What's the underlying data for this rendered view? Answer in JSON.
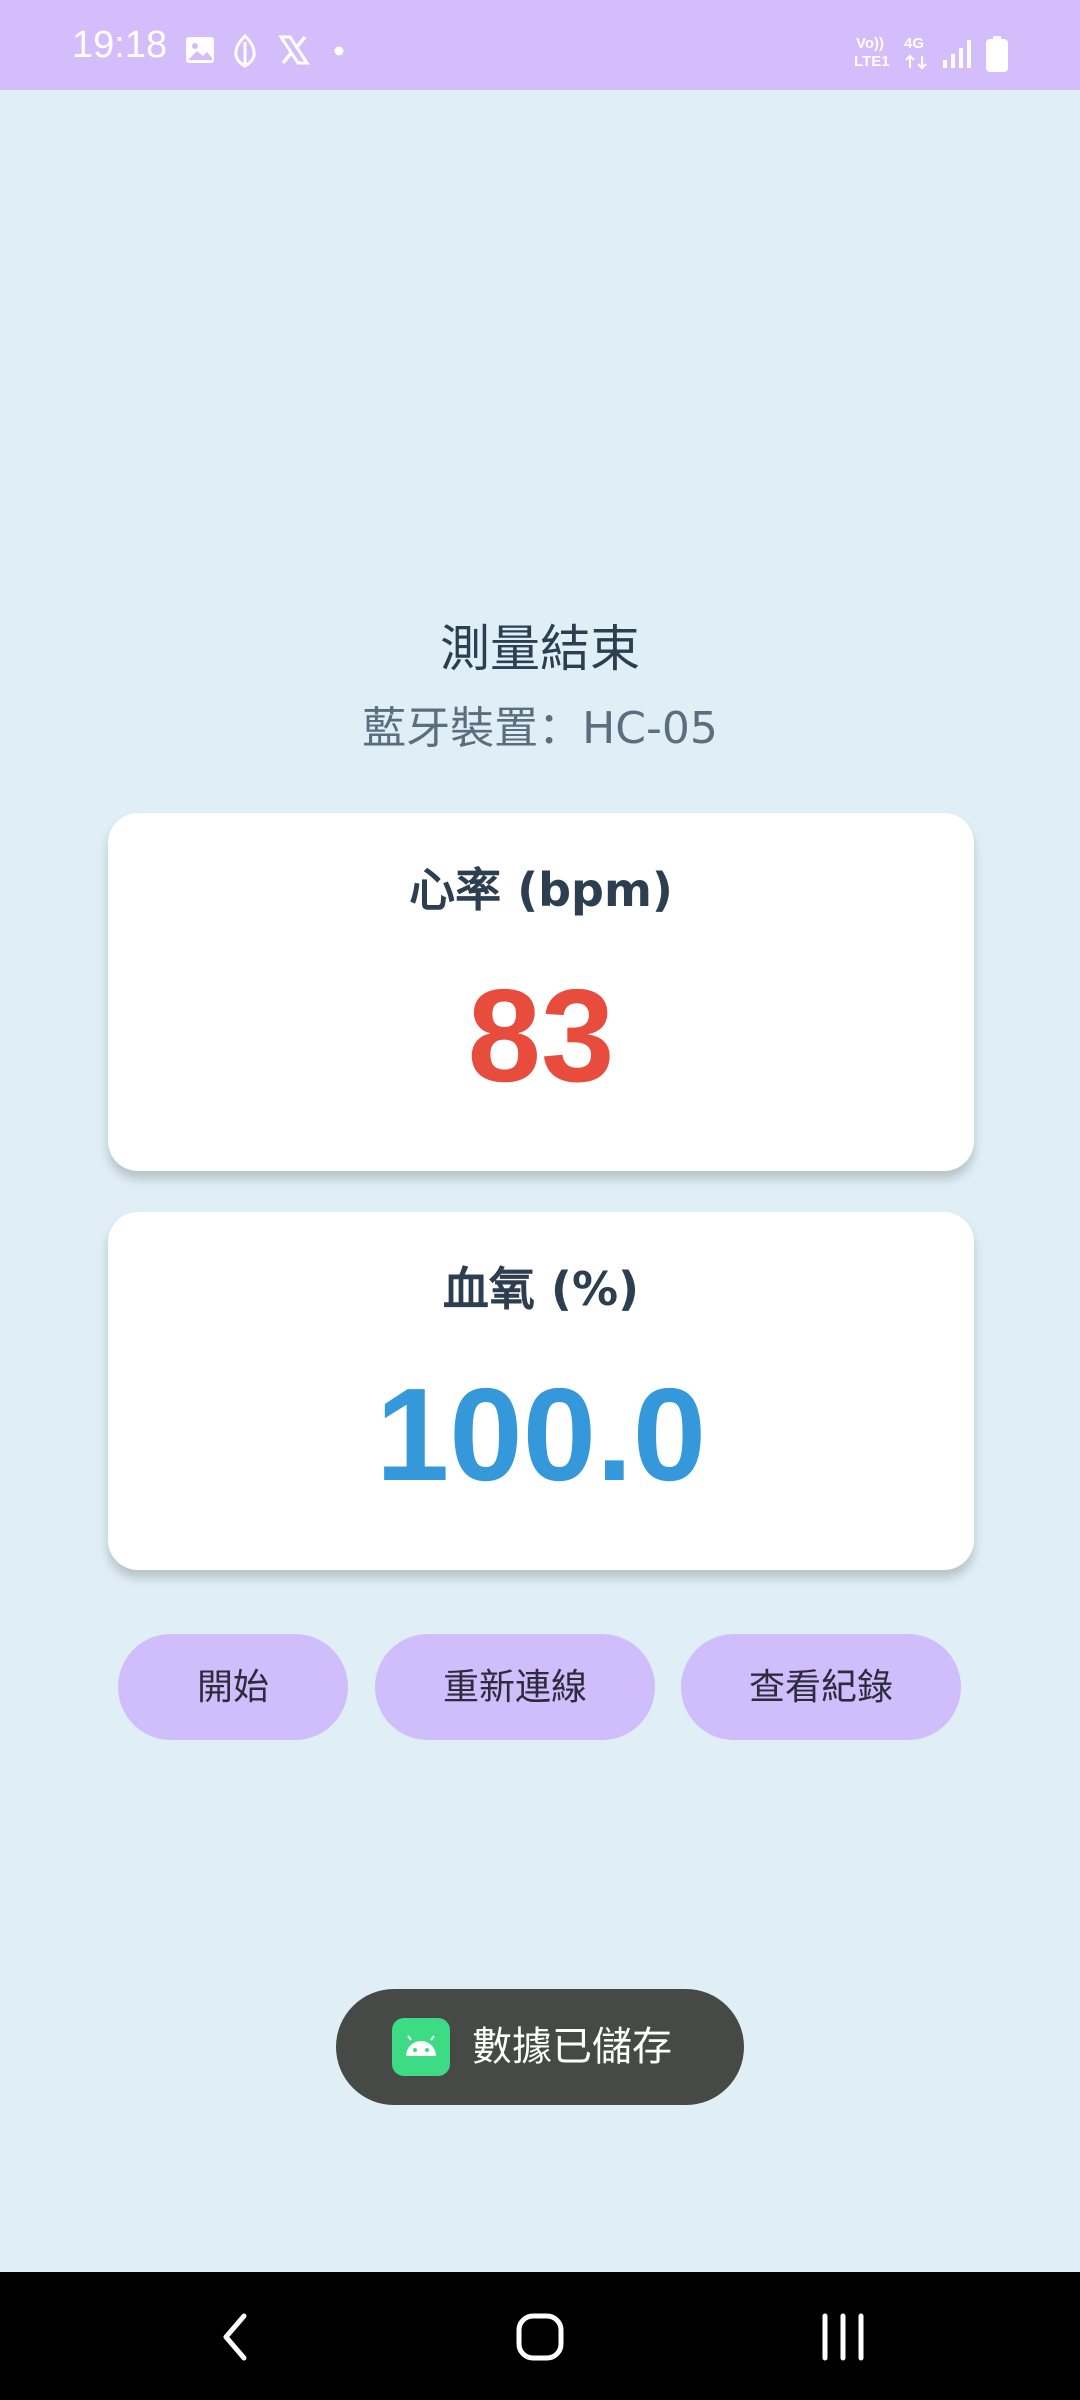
{
  "status_bar": {
    "time": "19:18",
    "left_icons": [
      "gallery-icon",
      "app-leaf-icon",
      "x-logo-icon",
      "dot-icon"
    ],
    "network_top": "Vo))",
    "network_bottom": "LTE1",
    "network_type": "4G",
    "right_icons": [
      "signal-icon",
      "battery-icon"
    ]
  },
  "header": {
    "title": "測量結束",
    "device": "藍牙裝置：HC-05"
  },
  "heart_rate_card": {
    "label": "心率 (bpm)",
    "value": "83",
    "color": "#e74c3c"
  },
  "spo2_card": {
    "label": "血氧 (%)",
    "value": "100.0",
    "color": "#3498db"
  },
  "buttons": {
    "start": "開始",
    "reconnect": "重新連線",
    "view_records": "查看紀錄"
  },
  "toast": {
    "message": "數據已儲存",
    "icon": "android-app-icon"
  },
  "nav_bar": {
    "icons": [
      "back-icon",
      "home-icon",
      "recents-icon"
    ]
  }
}
